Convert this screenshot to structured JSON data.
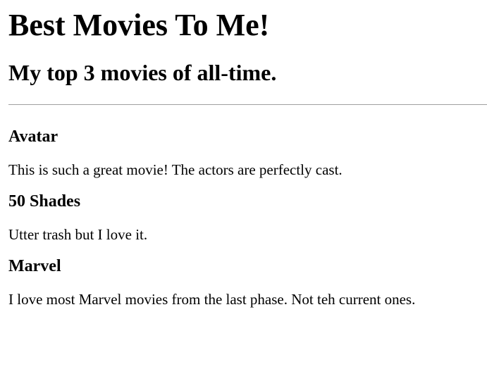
{
  "page": {
    "title": "Best Movies To Me!",
    "subtitle": "My top 3 movies of all-time."
  },
  "movies": [
    {
      "title": "Avatar",
      "description": "This is such a great movie! The actors are perfectly cast."
    },
    {
      "title": "50 Shades",
      "description": "Utter trash but I love it."
    },
    {
      "title": "Marvel",
      "description": "I love most Marvel movies from the last phase. Not teh current ones."
    }
  ]
}
